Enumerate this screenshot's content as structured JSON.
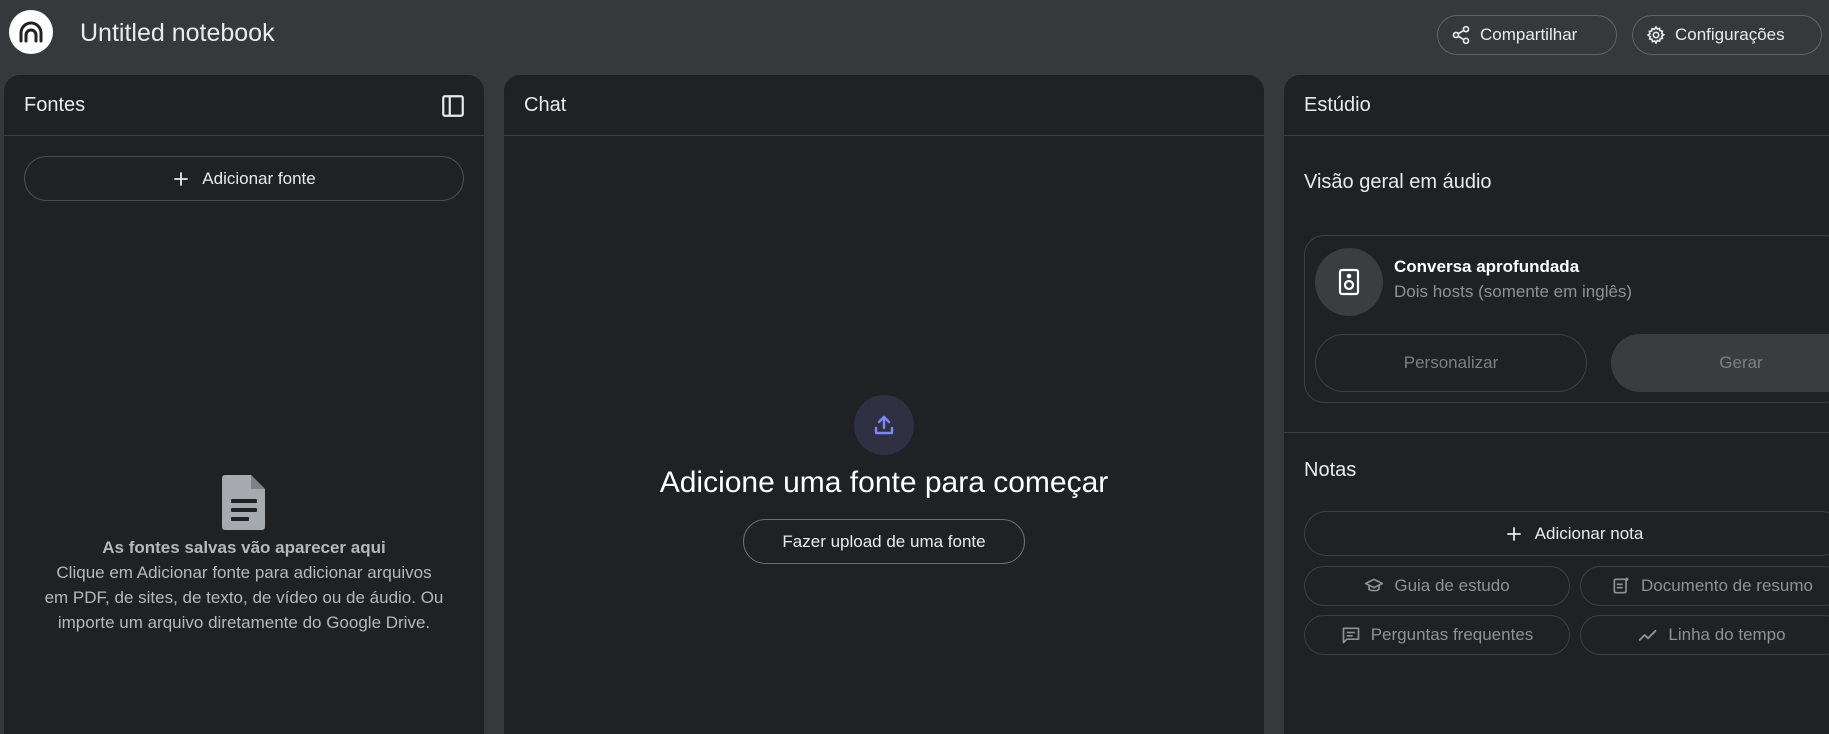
{
  "header": {
    "title": "Untitled notebook",
    "share_label": "Compartilhar",
    "settings_label": "Configurações"
  },
  "sources": {
    "title": "Fontes",
    "add_label": "Adicionar fonte",
    "empty_title": "As fontes salvas vão aparecer aqui",
    "empty_desc_lines": [
      "Clique em Adicionar fonte para adicionar arquivos",
      "em PDF, de sites, de texto, de vídeo ou de áudio. Ou",
      "importe um arquivo diretamente do Google Drive."
    ]
  },
  "chat": {
    "title": "Chat",
    "empty_title": "Adicione uma fonte para começar",
    "upload_label": "Fazer upload de uma fonte"
  },
  "studio": {
    "title": "Estúdio",
    "audio_section": "Visão geral em áudio",
    "audio_card_title": "Conversa aprofundada",
    "audio_card_sub": "Dois hosts (somente em inglês)",
    "customize_label": "Personalizar",
    "generate_label": "Gerar",
    "notes_section": "Notas",
    "add_note_label": "Adicionar nota",
    "chips": [
      "Guia de estudo",
      "Documento de resumo",
      "Perguntas frequentes",
      "Linha do tempo"
    ]
  },
  "icons": {
    "logo": "notebooklm-logo-icon",
    "share": "share-icon",
    "settings": "gear-icon",
    "collapse": "sidebar-collapse-icon",
    "add": "plus-icon",
    "document": "document-icon",
    "upload": "upload-icon",
    "speaker": "speaker-icon",
    "study_guide": "graduation-cap-icon",
    "summary_doc": "document-sparkle-icon",
    "faq": "chat-lines-icon",
    "timeline": "trending-line-icon"
  },
  "colors": {
    "background": "#37383c",
    "panel": "#202124",
    "accent_upload": "#7b86ff"
  }
}
